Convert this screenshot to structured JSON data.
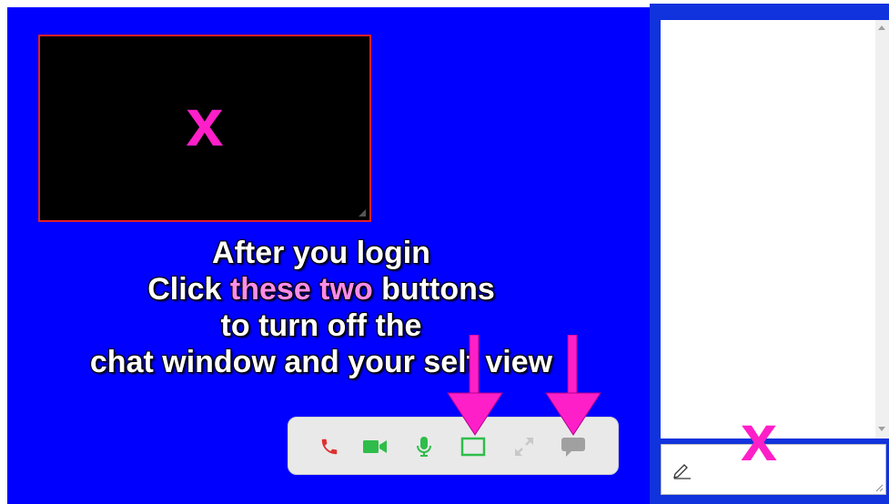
{
  "self_view": {
    "overlay_mark": "x"
  },
  "instruction": {
    "line1": "After you login",
    "line2_before": "Click ",
    "line2_highlight": "these two",
    "line2_after": " buttons",
    "line3": "to turn off the",
    "line4": "chat window and your self view"
  },
  "toolbar": {
    "buttons": [
      {
        "name": "hang-up",
        "icon": "phone-icon",
        "color": "#e03030"
      },
      {
        "name": "camera",
        "icon": "video-camera-icon",
        "color": "#2ebd4a"
      },
      {
        "name": "microphone",
        "icon": "microphone-icon",
        "color": "#2ebd4a"
      },
      {
        "name": "self-view-toggle",
        "icon": "self-view-icon",
        "color": "#2ebd4a"
      },
      {
        "name": "fullscreen",
        "icon": "expand-icon",
        "color": "#c8c8c8"
      },
      {
        "name": "chat-toggle",
        "icon": "chat-bubble-icon",
        "color": "#a0a0a0"
      }
    ]
  },
  "chat": {
    "overlay_mark": "x",
    "input_value": ""
  },
  "colors": {
    "main_background": "#0000ff",
    "side_frame": "#1133dd",
    "marker": "#ff1fc8",
    "highlight_text": "#ff8be9",
    "self_view_border": "#e0202a"
  }
}
